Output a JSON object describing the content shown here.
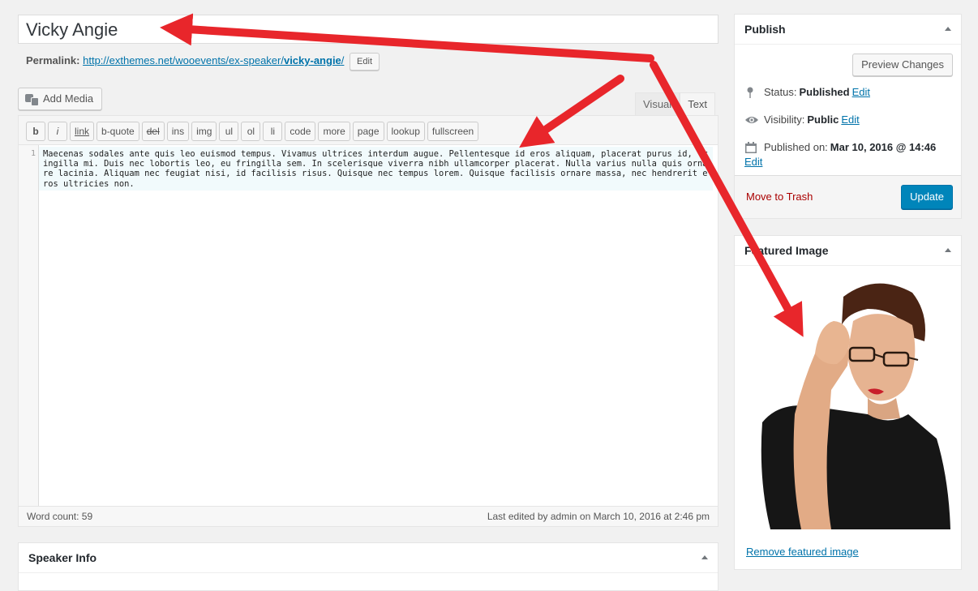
{
  "post": {
    "title": "Vicky Angie",
    "permalink_label": "Permalink:",
    "permalink_base": "http://exthemes.net/wooevents/ex-speaker/",
    "permalink_slug": "vicky-angie",
    "permalink_trail": "/",
    "permalink_edit": "Edit"
  },
  "editor": {
    "add_media": "Add Media",
    "tab_visual": "Visual",
    "tab_text": "Text",
    "quicktags": [
      "b",
      "i",
      "link",
      "b-quote",
      "del",
      "ins",
      "img",
      "ul",
      "ol",
      "li",
      "code",
      "more",
      "page",
      "lookup",
      "fullscreen"
    ],
    "line_number": "1",
    "content": "Maecenas sodales ante quis leo euismod tempus. Vivamus ultrices interdum augue. Pellentesque id eros aliquam, placerat purus id, fringilla mi. Duis nec lobortis leo, eu fringilla sem. In scelerisque viverra nibh ullamcorper placerat. Nulla varius nulla quis ornare lacinia. Aliquam nec feugiat nisi, id facilisis risus. Quisque nec tempus lorem. Quisque facilisis ornare massa, nec hendrerit eros ultricies non.",
    "word_count": "Word count: 59",
    "last_edited": "Last edited by admin on March 10, 2016 at 2:46 pm"
  },
  "speaker_info": {
    "title": "Speaker Info"
  },
  "publish": {
    "title": "Publish",
    "preview": "Preview Changes",
    "status_label": "Status:",
    "status_value": "Published",
    "visibility_label": "Visibility:",
    "visibility_value": "Public",
    "published_label": "Published on:",
    "published_value": "Mar 10, 2016 @ 14:46",
    "edit": "Edit",
    "trash": "Move to Trash",
    "update": "Update"
  },
  "featured": {
    "title": "Featured Image",
    "remove": "Remove featured image"
  },
  "colors": {
    "accent": "#0085ba",
    "link": "#0073aa",
    "arrow": "#e8262b",
    "danger": "#aa0000"
  }
}
